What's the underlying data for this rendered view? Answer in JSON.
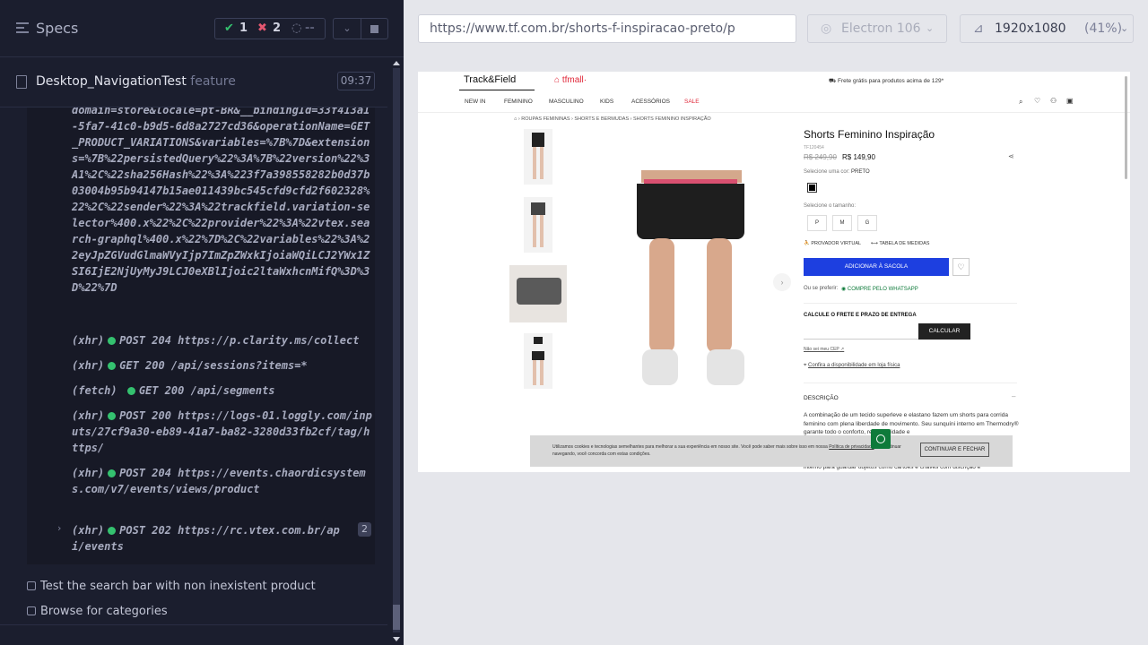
{
  "reporter": {
    "title": "Specs",
    "passed": "1",
    "failed": "2",
    "pending": "--",
    "spec_file": "Desktop_NavigationTest",
    "spec_ext": "feature",
    "duration": "09:37",
    "log_url_text": "domain=store&locale=pt-BR&__bindingId=33f413a1-5fa7-41c0-b9d5-6d8a2727cd36&operationName=GET_PRODUCT_VARIATIONS&variables=%7B%7D&extensions=%7B%22persistedQuery%22%3A%7B%22version%22%3A1%2C%22sha256Hash%22%3A%223f7a398558282b0d37b03004b95b94147b15ae011439bc545cfd9cfd2f602328%22%2C%22sender%22%3A%22trackfield.variation-selector%400.x%22%2C%22provider%22%3A%22vtex.search-graphql%400.x%22%7D%2C%22variables%22%3A%22eyJpZGVudGlmaWVyIjp7ImZpZWxkIjoiaWQiLCJ2YWx1ZSI6IjE2NjUyMyJ9LCJ0eXBlIjoic2ltaWxhcnMifQ%3D%3D%22%7D",
    "log_entries": [
      {
        "type": "(xhr)",
        "text": "POST 204 https://p.clarity.ms/collect"
      },
      {
        "type": "(xhr)",
        "text": "GET 200 /api/sessions?items=*"
      },
      {
        "type": "(fetch)",
        "text": "GET 200 /api/segments"
      },
      {
        "type": "(xhr)",
        "text": "POST 200 https://logs-01.loggly.com/inputs/27cf9a30-eb89-41a7-ba82-3280d33fb2cf/tag/https/"
      },
      {
        "type": "(xhr)",
        "text": "POST 204 https://events.chaordicsystems.com/v7/events/views/product"
      },
      {
        "type": "(xhr)",
        "text": "POST 202 https://rc.vtex.com.br/api/events",
        "count": "2"
      }
    ],
    "tests": [
      "Test the search bar with non inexistent product",
      "Browse for categories"
    ]
  },
  "browser": {
    "url": "https://www.tf.com.br/shorts-f-inspiracao-preto/p",
    "name": "Electron 106",
    "viewport": "1920x1080",
    "scale": "(41%)"
  },
  "site": {
    "brand": "Track&Field",
    "mall": "tfmall",
    "shipping_banner": "Frete grátis para produtos acima de 129*",
    "nav": [
      "NEW IN",
      "FEMININO",
      "MASCULINO",
      "KIDS",
      "ACESSÓRIOS",
      "SALE"
    ],
    "breadcrumb": [
      "ROUPAS FEMININAS",
      "SHORTS E BERMUDAS",
      "SHORTS FEMININO INSPIRAÇÃO"
    ],
    "product_title": "Shorts Feminino Inspiração",
    "sku": "TF120454",
    "old_price": "R$ 249,90",
    "price": "R$ 149,90",
    "color_label": "Selecione uma cor:",
    "color_value": "PRETO",
    "size_label": "Selecione o tamanho:",
    "sizes": [
      "P",
      "M",
      "G"
    ],
    "virtual_fitter": "PROVADOR VIRTUAL",
    "size_chart": "TABELA DE MEDIDAS",
    "add_to_bag": "ADICIONAR À SACOLA",
    "or_prefer": "Ou se preferir:",
    "whatsapp_buy": "COMPRE PELO WHATSAPP",
    "shipping_calc": "CALCULE O FRETE E PRAZO DE ENTREGA",
    "calc_button": "CALCULAR",
    "no_cep": "Não sei meu CEP",
    "store_availability": "Confira a disponibilidade em loja física",
    "description_heading": "DESCRIÇÃO",
    "description": "A combinação de um tecido superleve e elastano fazem um shorts para corrida feminino com plena liberdade de movimento. Seu sunquíni interno em Thermodry® garante todo o conforto, respirabilidade e",
    "description_tail": "interno para guardar objetos como cartões e chaves com discrição e",
    "cookie_text": "Utilizamos cookies e tecnologias semelhantes para melhorar a sua experiência em nosso site. Você pode saber mais sobre isso em nossa",
    "cookie_link": "Política de privacidade",
    "cookie_text2": ", ao continuar navegando, você concorda com estas condições.",
    "cookie_button": "CONTINUAR E FECHAR",
    "colors": {
      "accent_blue": "#1d3fe0",
      "sale_red": "#e0283a",
      "whatsapp_green": "#0e7a3a"
    }
  }
}
